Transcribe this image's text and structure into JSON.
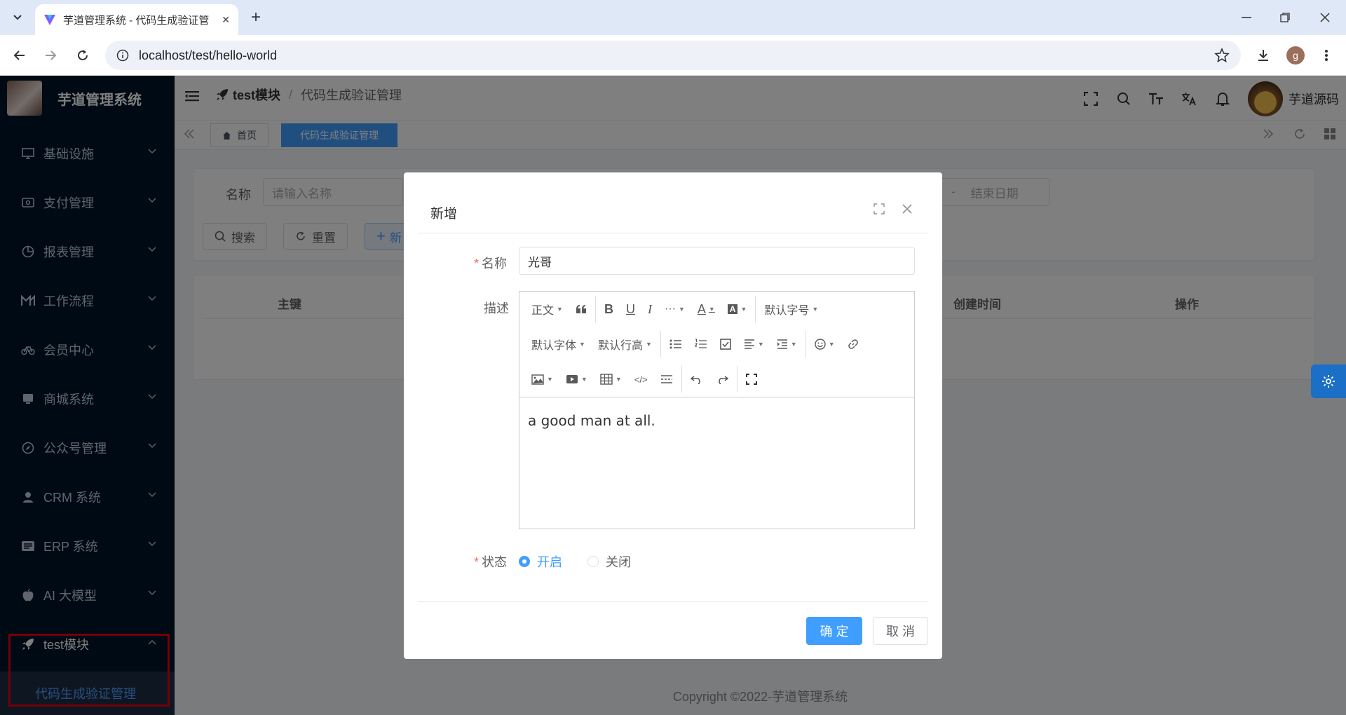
{
  "browser": {
    "tab_title": "芋道管理系统 - 代码生成验证管",
    "url": "localhost/test/hello-world",
    "profile_initial": "g"
  },
  "app": {
    "logo_title": "芋道管理系统",
    "menu": [
      {
        "label": "基础设施",
        "icon": "monitor-icon"
      },
      {
        "label": "支付管理",
        "icon": "wallet-icon"
      },
      {
        "label": "报表管理",
        "icon": "pie-chart-icon"
      },
      {
        "label": "工作流程",
        "icon": "flow-icon"
      },
      {
        "label": "会员中心",
        "icon": "bicycle-icon"
      },
      {
        "label": "商城系统",
        "icon": "shop-icon"
      },
      {
        "label": "公众号管理",
        "icon": "compass-icon"
      },
      {
        "label": "CRM 系统",
        "icon": "user-icon"
      },
      {
        "label": "ERP 系统",
        "icon": "erp-icon"
      },
      {
        "label": "AI 大模型",
        "icon": "apple-icon"
      },
      {
        "label": "test模块",
        "icon": "rocket-icon"
      }
    ],
    "submenu_active": "代码生成验证管理",
    "breadcrumb": {
      "module": "test模块",
      "current": "代码生成验证管理"
    },
    "username": "芋道源码",
    "tags": {
      "home": "首页",
      "active": "代码生成验证管理"
    },
    "search": {
      "name_label": "名称",
      "name_placeholder": "请输入名称",
      "date_separator": "-",
      "end_date_placeholder": "结束日期",
      "search_button": "搜索",
      "reset_button": "重置",
      "add_button_partial": "新"
    },
    "table_headers": {
      "id": "主键",
      "create_time": "创建时间",
      "actions": "操作"
    },
    "footer": "Copyright ©2022-芋道管理系统"
  },
  "dialog": {
    "title": "新增",
    "name_label": "名称",
    "name_value": "光哥",
    "desc_label": "描述",
    "editor": {
      "paragraph": "正文",
      "font_size": "默认字号",
      "font_family": "默认字体",
      "line_height": "默认行高",
      "content": "a good man at all."
    },
    "status_label": "状态",
    "status_on": "开启",
    "status_off": "关闭",
    "status_selected": "开启",
    "confirm": "确 定",
    "cancel": "取 消"
  }
}
